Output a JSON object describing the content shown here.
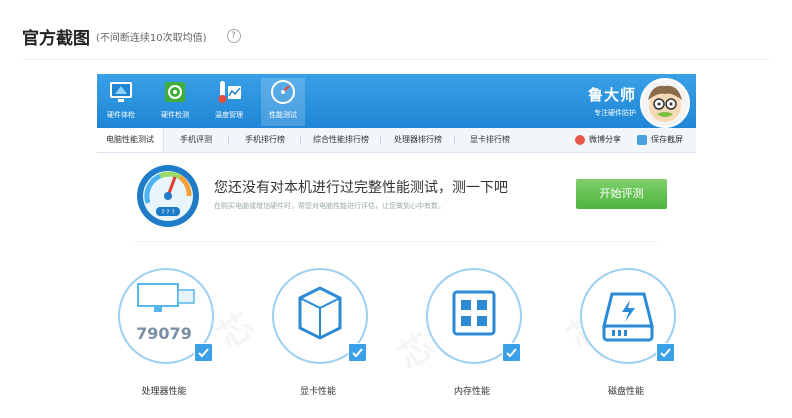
{
  "header": {
    "title": "官方截图",
    "subtitle": "(不间断连续10次取均值)",
    "help_icon": "?"
  },
  "toolbar": {
    "items": [
      {
        "label": "硬件体检",
        "icon": "monitor-icon"
      },
      {
        "label": "硬件检测",
        "icon": "chip-icon"
      },
      {
        "label": "温度管理",
        "icon": "thermometer-icon"
      },
      {
        "label": "性能测试",
        "icon": "gauge-icon",
        "active": true
      }
    ]
  },
  "brand": {
    "name": "鲁大师",
    "slogan": "专注硬件防护"
  },
  "tabs": [
    "电脑性能测试",
    "手机评测",
    "手机排行榜",
    "综合性能排行榜",
    "处理器排行榜",
    "显卡排行榜"
  ],
  "tab_actions": {
    "share": "微博分享",
    "save": "保存截屏"
  },
  "banner": {
    "title": "您还没有对本机进行过完整性能测试，测一下吧",
    "subtitle": "在购买电脑或增加硬件时，帮您对电脑性能进行评估，让您做到心中有数。",
    "gauge_label": "? ? ?",
    "start_button": "开始评测"
  },
  "categories": [
    {
      "label": "处理器性能",
      "score": "79079",
      "icon": "cpu-monitor-icon"
    },
    {
      "label": "显卡性能",
      "icon": "graphics-cube-icon"
    },
    {
      "label": "内存性能",
      "icon": "memory-chip-icon"
    },
    {
      "label": "磁盘性能",
      "icon": "disk-drive-icon"
    }
  ],
  "colors": {
    "accent": "#1e86d5",
    "button": "#5cbc4a",
    "circle": "#9dd0f1"
  }
}
